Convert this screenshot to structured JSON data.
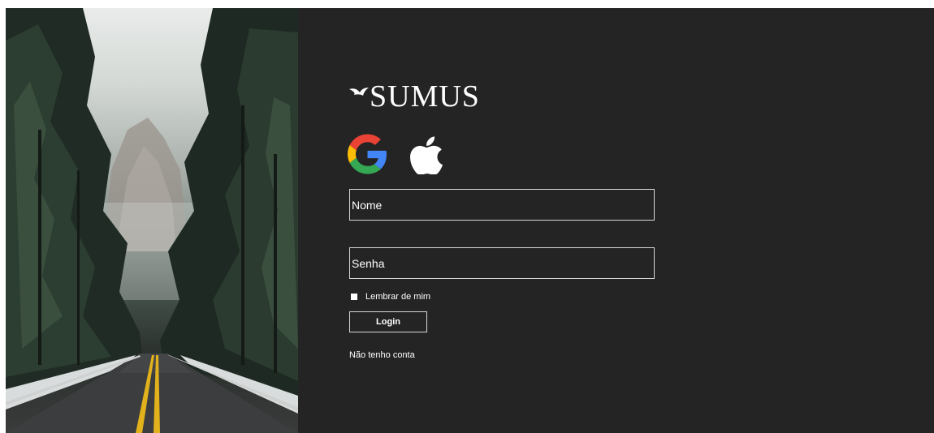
{
  "brand": {
    "name": "SUMUS",
    "logo_icon": "bird-logo-icon"
  },
  "social_login": [
    {
      "provider": "google",
      "icon": "google-icon"
    },
    {
      "provider": "apple",
      "icon": "apple-icon"
    }
  ],
  "form": {
    "name_placeholder": "Nome",
    "password_placeholder": "Senha",
    "remember_label": "Lembrar de mim",
    "login_label": "Login",
    "no_account_label": "Não tenho conta"
  },
  "colors": {
    "panel_background": "#242424",
    "text": "#ffffff",
    "field_border": "#d8d8d8"
  }
}
